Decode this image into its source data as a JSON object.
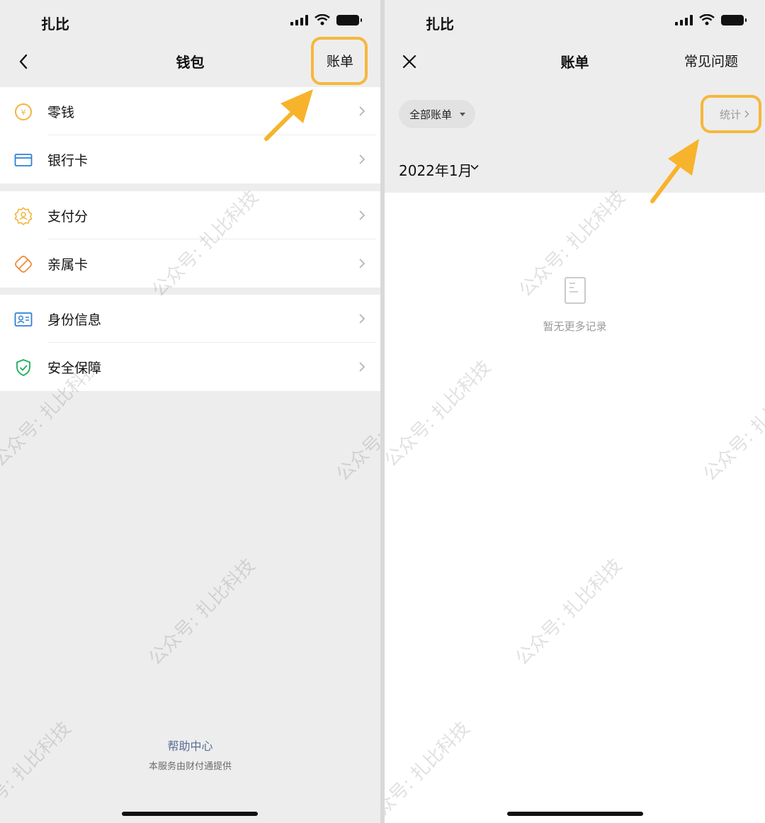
{
  "left": {
    "status": {
      "carrier": "扎比"
    },
    "nav": {
      "title": "钱包",
      "bill_link": "账单"
    },
    "groups": [
      {
        "items": [
          {
            "label": "零钱",
            "icon": "coin-icon"
          },
          {
            "label": "银行卡",
            "icon": "card-icon"
          }
        ]
      },
      {
        "items": [
          {
            "label": "支付分",
            "icon": "score-icon"
          },
          {
            "label": "亲属卡",
            "icon": "family-card-icon"
          }
        ]
      },
      {
        "items": [
          {
            "label": "身份信息",
            "icon": "id-icon"
          },
          {
            "label": "安全保障",
            "icon": "shield-icon"
          }
        ]
      }
    ],
    "footer": {
      "help": "帮助中心",
      "provider": "本服务由财付通提供"
    }
  },
  "right": {
    "status": {
      "carrier": "扎比"
    },
    "nav": {
      "title": "账单",
      "faq": "常见问题"
    },
    "filter": {
      "label": "全部账单"
    },
    "stats": {
      "label": "统计"
    },
    "month": {
      "label": "2022年1月"
    },
    "empty": {
      "text": "暂无更多记录"
    }
  },
  "watermark": "公众号: 扎比科技",
  "colors": {
    "highlight": "#f6b73c",
    "arrow": "#f7b32b",
    "link": "#5a6e96"
  }
}
